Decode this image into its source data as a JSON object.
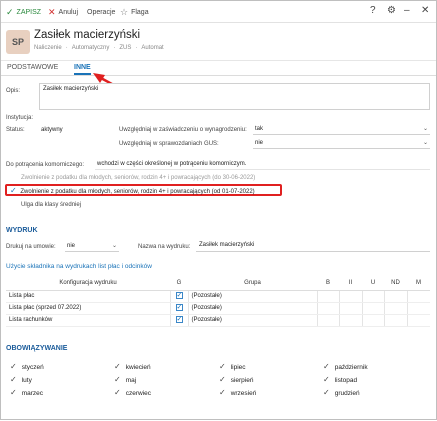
{
  "toolbar": {
    "save": "ZAPISZ",
    "cancel": "Anuluj",
    "operations": "Operacje",
    "flag": "Flaga"
  },
  "header": {
    "avatar": "SP",
    "title": "Zasiłek macierzyński",
    "crumbs": [
      "Naliczenie",
      "·",
      "Automatyczny",
      "·",
      "ZUS",
      "·",
      "Automat"
    ]
  },
  "tabs": [
    "PODSTAWOWE",
    "INNE"
  ],
  "form": {
    "opis_label": "Opis:",
    "opis_value": "Zasiłek macierzyński",
    "instytucja_label": "Instytucja:",
    "status_label": "Status:",
    "status_value": "aktywny",
    "zaswiadczenie_label": "Uwzględniaj w zaświadczeniu o wynagrodzeniu:",
    "zaswiadczenie_value": "tak",
    "gus_label": "Uwzględniaj w sprawozdaniach GUS:",
    "gus_value": "nie",
    "komornicze_label": "Do potrącenia komorniczego:",
    "komornicze_value": "wchodzi w części określonej w potrąceniu komorniczym.",
    "zwolnienie_old": "Zwolnienie z podatku dla młodych, seniorów, rodzin 4+ i powracających (do 30-06-2022)",
    "zwolnienie_new": "Zwolnienie z podatku dla młodych, seniorów, rodzin 4+ i powracających (od 01-07-2022)",
    "ulga": "Ulga dla klasy średniej"
  },
  "wydruk": {
    "section": "WYDRUK",
    "drukuj_label": "Drukuj na umowie:",
    "drukuj_value": "nie",
    "nazwa_label": "Nazwa na wydruku:",
    "nazwa_value": "Zasiłek macierzyński",
    "subtitle": "Użycie składnika na wydrukach list płac i odcinków"
  },
  "table": {
    "headers": [
      "Konfiguracja wydruku",
      "G",
      "Grupa",
      "B",
      "II",
      "U",
      "ND",
      "M"
    ],
    "rows": [
      {
        "name": "Lista płac",
        "grupa": "(Pozostałe)"
      },
      {
        "name": "Lista płac (sprzed 07.2022)",
        "grupa": "(Pozostałe)"
      },
      {
        "name": "Lista rachunków",
        "grupa": "(Pozostałe)"
      }
    ]
  },
  "obowiazywanie": {
    "section": "OBOWIĄZYWANIE",
    "months": [
      "styczeń",
      "luty",
      "marzec",
      "kwiecień",
      "maj",
      "czerwiec",
      "lipiec",
      "sierpień",
      "wrzesień",
      "październik",
      "listopad",
      "grudzień"
    ]
  }
}
